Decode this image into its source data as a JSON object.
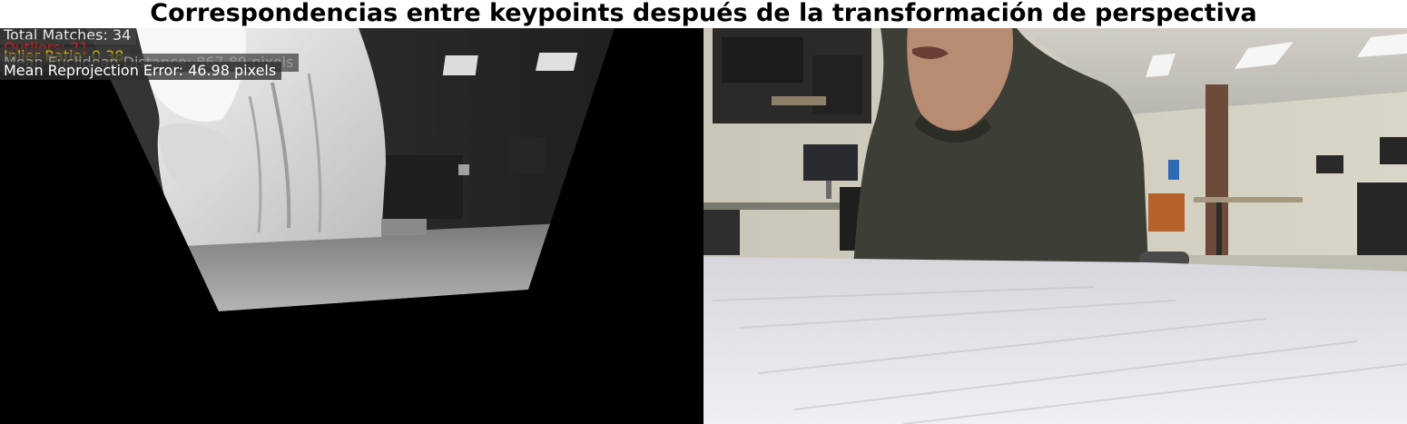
{
  "figure": {
    "title": "Correspondencias entre keypoints después de la transformación de perspectiva"
  },
  "panels": {
    "left": {
      "name": "warped-thermal-image"
    },
    "right": {
      "name": "rgb-camera-image"
    }
  },
  "stats": {
    "total_matches": "Total Matches: 34",
    "outliers": "Outliers: 21",
    "inlier_ratio": "Inlier Ratio: 0.38",
    "mean_euclidean": "Mean Euclidean Distance: 867.89 pixels",
    "mean_reprojection": "Mean Reprojection Error: 46.98 pixels"
  },
  "colors": {
    "total_matches": "#e6e6e6",
    "outliers": "#c81e1e",
    "inlier_ratio": "#c8b400",
    "mean_euclidean": "#9a9a9a",
    "mean_reprojection": "#ffffff"
  }
}
